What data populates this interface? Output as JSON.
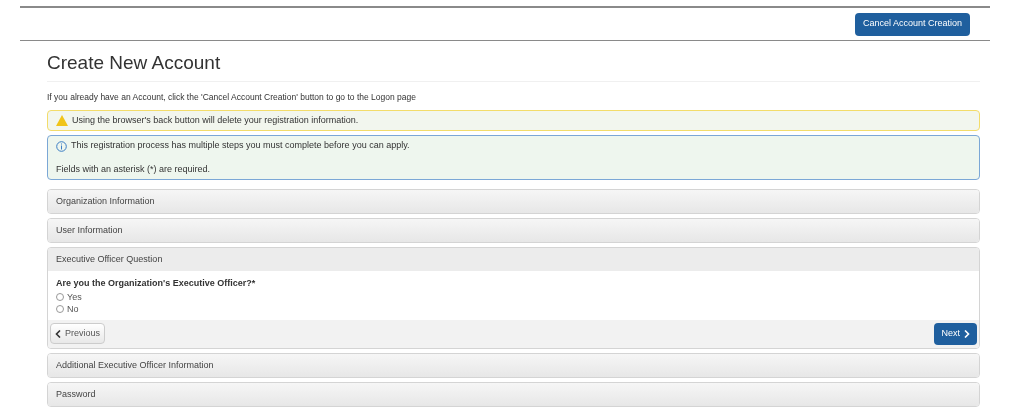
{
  "header": {
    "cancel_button": "Cancel Account Creation"
  },
  "title": "Create New Account",
  "intro": "If you already have an Account, click the 'Cancel Account Creation' button to go to the Logon page",
  "alerts": [
    {
      "kind": "warning",
      "lines": [
        "Using the browser's back button will delete your registration information."
      ]
    },
    {
      "kind": "info",
      "lines": [
        "This registration process has multiple steps you must complete before you can apply.",
        "Fields with an asterisk (*) are required."
      ]
    }
  ],
  "sections": [
    {
      "title": "Organization Information",
      "expanded": false
    },
    {
      "title": "User Information",
      "expanded": false
    },
    {
      "title": "Executive Officer Question",
      "expanded": true,
      "question": "Are you the Organization's Executive Officer?*",
      "options": [
        {
          "label": "Yes",
          "selected": false
        },
        {
          "label": "No",
          "selected": false
        }
      ],
      "previous": "Previous",
      "next": "Next"
    },
    {
      "title": "Additional Executive Officer Information",
      "expanded": false
    },
    {
      "title": "Password",
      "expanded": false
    }
  ]
}
